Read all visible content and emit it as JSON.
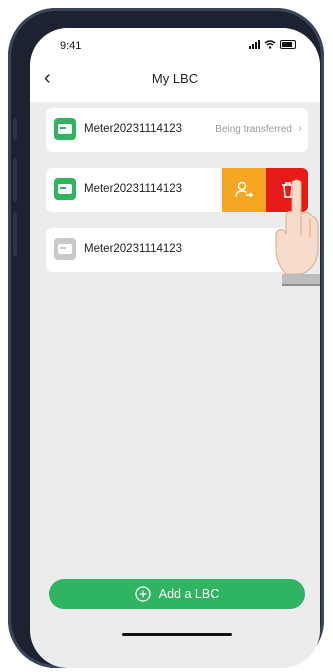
{
  "status_bar": {
    "time": "9:41"
  },
  "nav": {
    "title": "My LBC",
    "back_icon": "chevron-left-icon"
  },
  "meters": [
    {
      "name": "Meter20231114123",
      "status": "Being transferred",
      "icon": "meter-icon",
      "icon_state": "active",
      "has_chevron": true
    },
    {
      "name": "Meter20231114123",
      "status": "",
      "icon": "meter-icon",
      "icon_state": "active",
      "swiped_open": true
    },
    {
      "name": "Meter20231114123",
      "status": "",
      "icon": "meter-icon",
      "icon_state": "inactive"
    }
  ],
  "swipe_actions": [
    {
      "icon": "transfer-user-icon",
      "color": "#f5a623"
    },
    {
      "icon": "trash-icon",
      "color": "#e81919"
    }
  ],
  "add_button": {
    "label": "Add a LBC",
    "icon": "plus-circle-icon"
  },
  "colors": {
    "brand_green": "#2fb561",
    "transfer_orange": "#f5a623",
    "delete_red": "#e81919",
    "background": "#ececec"
  }
}
